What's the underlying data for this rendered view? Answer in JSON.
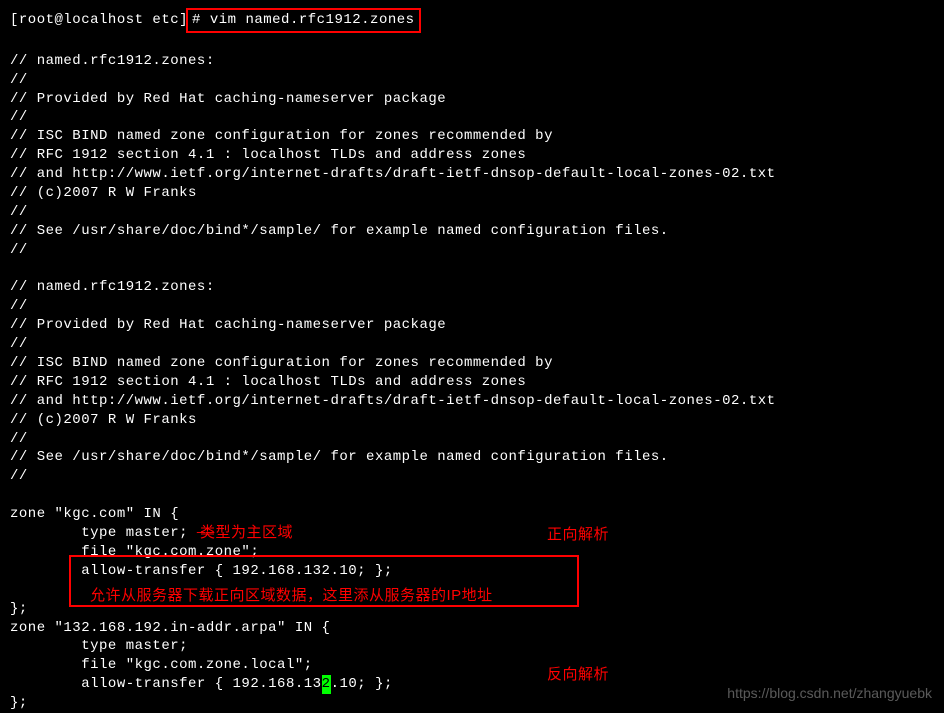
{
  "prompt": {
    "user_host": "[root@localhost etc]",
    "command": "# vim named.rfc1912.zones"
  },
  "file_header_1": [
    "// named.rfc1912.zones:",
    "//",
    "// Provided by Red Hat caching-nameserver package",
    "//",
    "// ISC BIND named zone configuration for zones recommended by",
    "// RFC 1912 section 4.1 : localhost TLDs and address zones",
    "// and http://www.ietf.org/internet-drafts/draft-ietf-dnsop-default-local-zones-02.txt",
    "// (c)2007 R W Franks",
    "//",
    "// See /usr/share/doc/bind*/sample/ for example named configuration files.",
    "//"
  ],
  "file_header_2": [
    "// named.rfc1912.zones:",
    "//",
    "// Provided by Red Hat caching-nameserver package",
    "//",
    "// ISC BIND named zone configuration for zones recommended by",
    "// RFC 1912 section 4.1 : localhost TLDs and address zones",
    "// and http://www.ietf.org/internet-drafts/draft-ietf-dnsop-default-local-zones-02.txt",
    "// (c)2007 R W Franks",
    "//",
    "// See /usr/share/doc/bind*/sample/ for example named configuration files.",
    "//"
  ],
  "zone_forward": {
    "decl": "zone \"kgc.com\" IN {",
    "type": "        type master;",
    "file": "        file \"kgc.com.zone\";",
    "allow": "        allow-transfer { 192.168.132.10; };",
    "close": "};"
  },
  "zone_reverse": {
    "decl": "zone \"132.168.192.in-addr.arpa\" IN {",
    "type": "        type master;",
    "file": "        file \"kgc.com.zone.local\";",
    "allow_pre": "        allow-transfer { 192.168.13",
    "allow_cursor": "2",
    "allow_post": ".10; };",
    "close": "};"
  },
  "annotations": {
    "dash": " —— ",
    "type_label": "类型为主区域",
    "forward_label": "正向解析",
    "allow_label": "允许从服务器下载正向区域数据，这里添从服务器的IP地址",
    "reverse_label": "反向解析"
  },
  "watermark": "https://blog.csdn.net/zhangyuebk"
}
